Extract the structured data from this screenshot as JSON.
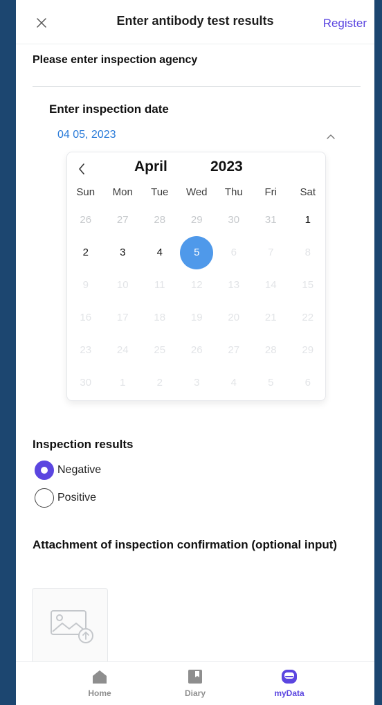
{
  "header": {
    "title": "Enter antibody test results",
    "register_label": "Register"
  },
  "agency": {
    "label": "Please enter inspection agency",
    "value": ""
  },
  "date": {
    "label": "Enter inspection date",
    "value": "04 05, 2023"
  },
  "calendar": {
    "month": "April",
    "year": "2023",
    "weekdays": [
      "Sun",
      "Mon",
      "Tue",
      "Wed",
      "Thu",
      "Fri",
      "Sat"
    ],
    "selected_day": "5",
    "days": [
      {
        "n": "26",
        "s": "other"
      },
      {
        "n": "27",
        "s": "other"
      },
      {
        "n": "28",
        "s": "other"
      },
      {
        "n": "29",
        "s": "other"
      },
      {
        "n": "30",
        "s": "other"
      },
      {
        "n": "31",
        "s": "other"
      },
      {
        "n": "1",
        "s": "cur"
      },
      {
        "n": "2",
        "s": "cur"
      },
      {
        "n": "3",
        "s": "cur"
      },
      {
        "n": "4",
        "s": "cur"
      },
      {
        "n": "5",
        "s": "sel"
      },
      {
        "n": "6",
        "s": "muted"
      },
      {
        "n": "7",
        "s": "muted"
      },
      {
        "n": "8",
        "s": "muted"
      },
      {
        "n": "9",
        "s": "muted"
      },
      {
        "n": "10",
        "s": "muted"
      },
      {
        "n": "11",
        "s": "muted"
      },
      {
        "n": "12",
        "s": "muted"
      },
      {
        "n": "13",
        "s": "muted"
      },
      {
        "n": "14",
        "s": "muted"
      },
      {
        "n": "15",
        "s": "muted"
      },
      {
        "n": "16",
        "s": "muted"
      },
      {
        "n": "17",
        "s": "muted"
      },
      {
        "n": "18",
        "s": "muted"
      },
      {
        "n": "19",
        "s": "muted"
      },
      {
        "n": "20",
        "s": "muted"
      },
      {
        "n": "21",
        "s": "muted"
      },
      {
        "n": "22",
        "s": "muted"
      },
      {
        "n": "23",
        "s": "muted"
      },
      {
        "n": "24",
        "s": "muted"
      },
      {
        "n": "25",
        "s": "muted"
      },
      {
        "n": "26",
        "s": "muted"
      },
      {
        "n": "27",
        "s": "muted"
      },
      {
        "n": "28",
        "s": "muted"
      },
      {
        "n": "29",
        "s": "muted"
      },
      {
        "n": "30",
        "s": "muted"
      },
      {
        "n": "1",
        "s": "muted"
      },
      {
        "n": "2",
        "s": "muted"
      },
      {
        "n": "3",
        "s": "muted"
      },
      {
        "n": "4",
        "s": "muted"
      },
      {
        "n": "5",
        "s": "muted"
      },
      {
        "n": "6",
        "s": "muted"
      }
    ]
  },
  "results": {
    "label": "Inspection results",
    "options": [
      {
        "label": "Negative",
        "selected": true
      },
      {
        "label": "Positive",
        "selected": false
      }
    ]
  },
  "attachment": {
    "label": "Attachment of inspection confirmation (optional input)",
    "icon": "image-upload-icon"
  },
  "tabbar": {
    "tabs": [
      {
        "label": "Home",
        "icon": "home-icon",
        "active": false
      },
      {
        "label": "Diary",
        "icon": "diary-icon",
        "active": false
      },
      {
        "label": "myData",
        "icon": "mydata-icon",
        "active": true
      }
    ]
  },
  "colors": {
    "background": "#1c4670",
    "accent": "#5b46e0",
    "date_link": "#2a7bd9",
    "selected_day": "#4f99ea"
  }
}
